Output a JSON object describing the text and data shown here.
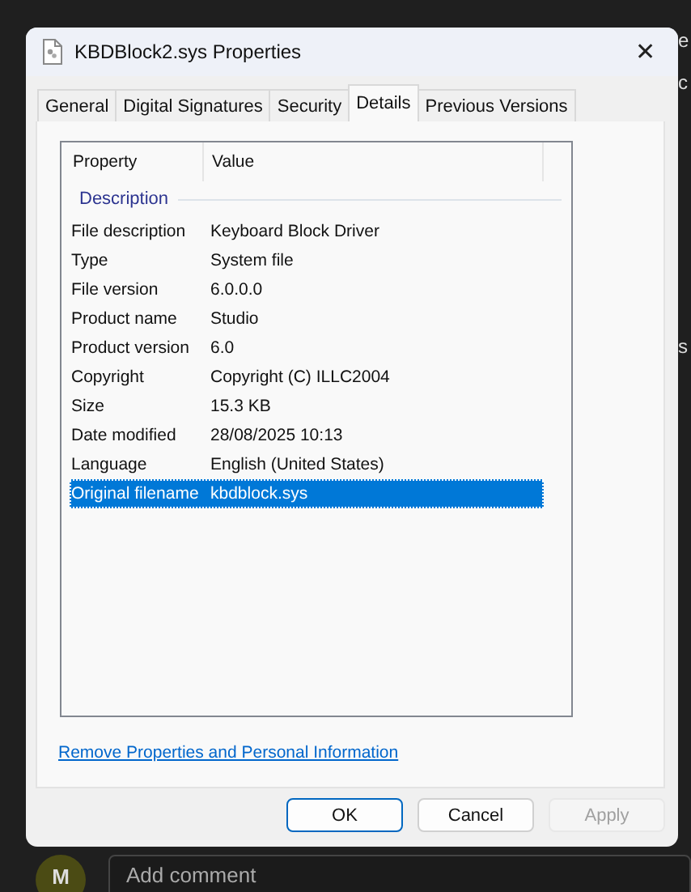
{
  "window": {
    "title": "KBDBlock2.sys Properties",
    "close": "✕"
  },
  "tabs": [
    {
      "label": "General",
      "selected": false
    },
    {
      "label": "Digital Signatures",
      "selected": false
    },
    {
      "label": "Security",
      "selected": false
    },
    {
      "label": "Details",
      "selected": true
    },
    {
      "label": "Previous Versions",
      "selected": false
    }
  ],
  "table": {
    "columns": [
      "Property",
      "Value"
    ],
    "group": "Description",
    "rows": [
      {
        "property": "File description",
        "value": "Keyboard Block Driver",
        "selected": false
      },
      {
        "property": "Type",
        "value": "System file",
        "selected": false
      },
      {
        "property": "File version",
        "value": "6.0.0.0",
        "selected": false
      },
      {
        "property": "Product name",
        "value": "Studio",
        "selected": false
      },
      {
        "property": "Product version",
        "value": "6.0",
        "selected": false
      },
      {
        "property": "Copyright",
        "value": "Copyright (C) ILLC2004",
        "selected": false
      },
      {
        "property": "Size",
        "value": "15.3 KB",
        "selected": false
      },
      {
        "property": "Date modified",
        "value": "28/08/2025 10:13",
        "selected": false
      },
      {
        "property": "Language",
        "value": "English (United States)",
        "selected": false
      },
      {
        "property": "Original filename",
        "value": "kbdblock.sys",
        "selected": true
      }
    ]
  },
  "link": "Remove Properties and Personal Information",
  "buttons": [
    {
      "label": "OK",
      "disabled": false,
      "default": true
    },
    {
      "label": "Cancel",
      "disabled": false,
      "default": false
    },
    {
      "label": "Apply",
      "disabled": true,
      "default": false
    }
  ],
  "background_fragments": [
    "e",
    "c",
    "s"
  ],
  "comment": {
    "avatar": "M",
    "placeholder": "Add comment"
  }
}
